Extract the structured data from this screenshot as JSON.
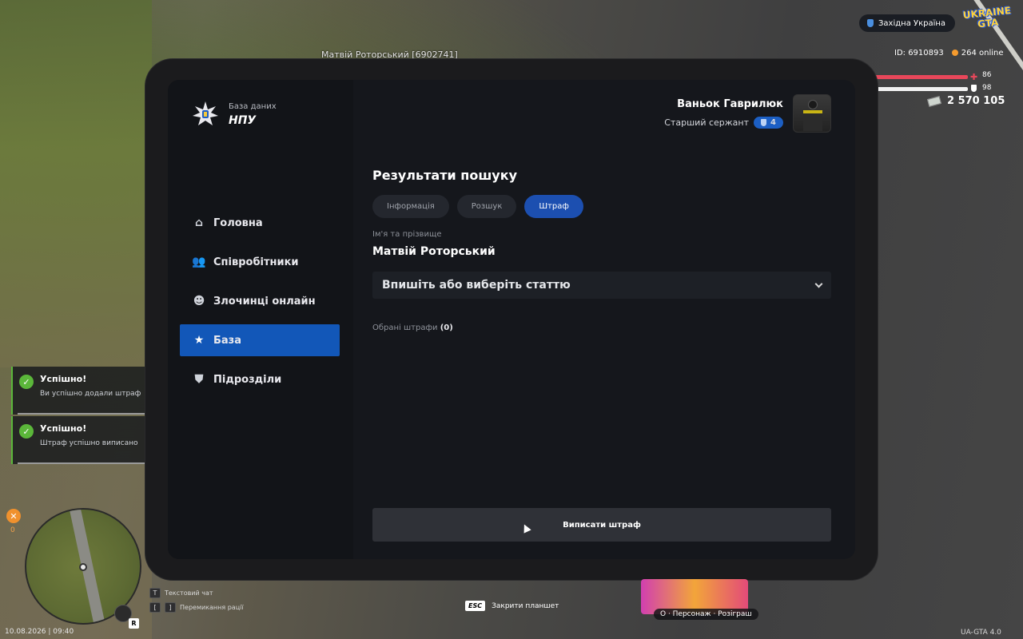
{
  "world": {
    "player_tag": "Матвій Роторський [6902741]"
  },
  "hud": {
    "server": "Західна Україна",
    "logo_line1": "UKRAINE",
    "logo_line2": "GTA",
    "player_id": "ID: 6910893",
    "online": "264 online",
    "health": "86",
    "armor": "98",
    "money": "2 570 105",
    "datetime": "10.08.2026 | 09:40",
    "minimap_counter": "0",
    "minimap_badge": "R",
    "hint_text_chat_key": "T",
    "hint_text_chat": "Текстовий чат",
    "hint_radio_key1": "[",
    "hint_radio_key2": "]",
    "hint_radio": "Перемикання рації",
    "esc_key": "ESC",
    "esc_label": "Закрити планшет",
    "promo_label": "O · Персонаж · Розіграш",
    "version": "UA-GTA 4.0"
  },
  "notifications": [
    {
      "title": "Успішно!",
      "message": "Ви успішно додали штраф"
    },
    {
      "title": "Успішно!",
      "message": "Штраф успішно виписано"
    }
  ],
  "tablet": {
    "brand_small": "База даних",
    "brand_big": "НПУ",
    "nav": [
      {
        "label": "Головна",
        "icon": "home-icon"
      },
      {
        "label": "Співробітники",
        "icon": "employees-icon"
      },
      {
        "label": "Злочинці онлайн",
        "icon": "criminal-icon"
      },
      {
        "label": "База",
        "icon": "star-icon",
        "active": true
      },
      {
        "label": "Підрозділи",
        "icon": "police-shield-icon"
      }
    ],
    "user": {
      "name": "Ваньок Гаврилюк",
      "rank": "Старший сержант",
      "rank_level": "4"
    },
    "section_title": "Результати пошуку",
    "tabs": [
      {
        "label": "Інформація"
      },
      {
        "label": "Розшук"
      },
      {
        "label": "Штраф",
        "active": true
      }
    ],
    "name_label": "Ім'я та прізвище",
    "name_value": "Матвій Роторський",
    "article_select_placeholder": "Впишіть або виберіть статтю",
    "chosen_label": "Обрані штрафи",
    "chosen_count": "(0)",
    "submit_label": "Виписати штраф"
  },
  "colors": {
    "accent": "#1257b8",
    "tab_active": "#1c4fb0",
    "success": "#5bb73a",
    "health": "#e8475a"
  }
}
